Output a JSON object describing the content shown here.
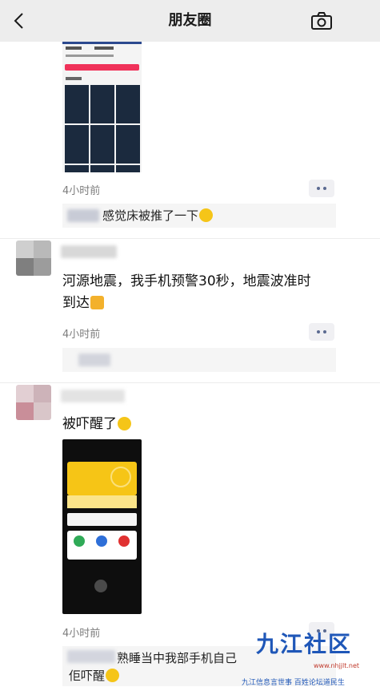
{
  "header": {
    "title": "朋友圈"
  },
  "posts": [
    {
      "time": "4小时前",
      "comment": "感觉床被推了一下"
    },
    {
      "text_line1": "河源地震，我手机预警30秒，地震波准时",
      "text_line2": "到达",
      "time": "4小时前"
    },
    {
      "text": "被吓醒了",
      "time": "4小时前",
      "comment_line1": "熟睡当中我部手机自己",
      "comment_line2": "佢吓醒"
    }
  ],
  "watermark": {
    "brand": "九江社区",
    "site": "www.nhjjlt.net",
    "slogan": "九江信息言世事 百姓论坛道民生"
  },
  "colors": {
    "topbar": "#ededed",
    "link_blue": "#5b6a91",
    "comment_bg": "#f5f5f5"
  }
}
